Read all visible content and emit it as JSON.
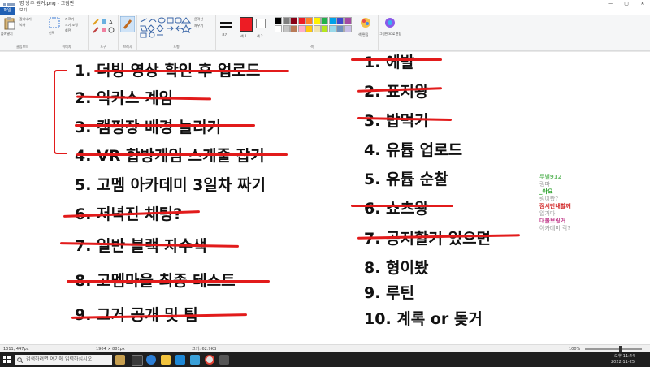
{
  "window": {
    "title": "명 방주 원거.png - 그림판",
    "minimize": "—",
    "maximize": "▢",
    "close": "✕"
  },
  "menu": {
    "file": "파일",
    "view": "보기"
  },
  "ribbon": {
    "clipboard": {
      "paste": "붙여넣기",
      "cut": "잘라내기",
      "copy": "복사",
      "label": "클립보드"
    },
    "image": {
      "select": "선택",
      "crop": "자르기",
      "resize": "크기 조정",
      "rotate": "회전",
      "label": "이미지"
    },
    "tools": {
      "label": "도구"
    },
    "brushes": {
      "label": "브러시"
    },
    "shapes": {
      "outline": "윤곽선",
      "fill": "채우기",
      "label": "도형"
    },
    "size": {
      "label": "크기"
    },
    "color1": {
      "label": "색 1"
    },
    "color2": {
      "label": "색 2"
    },
    "colors_label": "색",
    "edit_colors": "색 편집",
    "paint3d": "그림판 3D로 편집",
    "palette": [
      "#000000",
      "#7f7f7f",
      "#880015",
      "#ed1c24",
      "#ff7f27",
      "#fff200",
      "#22b14c",
      "#00a2e8",
      "#3f48cc",
      "#a349a4",
      "#ffffff",
      "#c3c3c3",
      "#b97a57",
      "#ffaec9",
      "#ffc90e",
      "#efe4b0",
      "#b5e61d",
      "#99d9ea",
      "#7092be",
      "#c8bfe7"
    ]
  },
  "left_list": [
    "1. 더빙 영상 확인 후 업로드",
    "2. 익카스 계임",
    "3. 캠핑장 배경 늘리기",
    "4. VR 합방게임 스케줄 잡기",
    "5. 고멤 아카데미 3일차 짜기",
    "6. 저녁진 채팅?",
    "7. 일반 블랙 자수색",
    "8. 고멤마을 최종 테스트",
    "9. 그거 공개 및 팁"
  ],
  "right_list": [
    "1. 에발",
    "2. 표지왕",
    "3. 밥먹기",
    "4. 유튭 업로드",
    "5. 유튭 순찰",
    "6. 쇼츠왕",
    "7. 공지할거 있으면",
    "8. 형이봤",
    "9. 루틴",
    "10. 계록 or 돚거"
  ],
  "chat": [
    {
      "name": "두별912",
      "msg": "링마",
      "color": "#6fbf6f"
    },
    {
      "name": "_야요",
      "msg": "링이봤?",
      "color": "#2aa02a"
    },
    {
      "name": "잠시만내할께",
      "msg": "알거다",
      "color": "#d22a2a"
    },
    {
      "name": "대불브링거",
      "msg": "아카데미 각?",
      "color": "#c03a8a"
    }
  ],
  "status": {
    "cursor": "1311, 447px",
    "selection": "1904 × 881px",
    "filesize": "크기: 62.9KB",
    "zoom": "100%"
  },
  "taskbar": {
    "search_placeholder": "검색하려면 여기에 입력하십시오",
    "time": "오후 11:44",
    "date": "2022-11-25"
  },
  "colors": {
    "strike": "#e21b1b",
    "accent": "#1f5fb4"
  }
}
